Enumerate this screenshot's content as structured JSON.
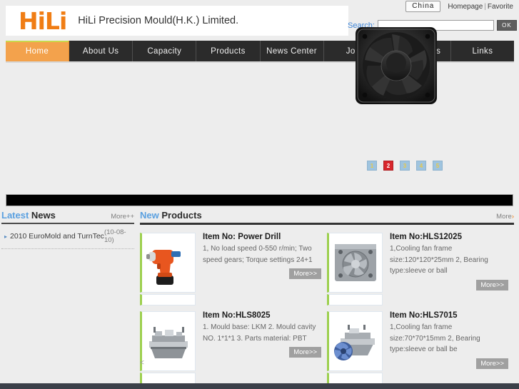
{
  "topbar": {
    "lang_button": "China",
    "homepage_link": "Homepage",
    "separator": "|",
    "favorite_link": "Favorite"
  },
  "header": {
    "logo_text": "HiLi",
    "company_name": "HiLi Precision Mould(H.K.) Limited."
  },
  "search": {
    "label": "Search:",
    "value": "",
    "placeholder": "",
    "button_label": "OK"
  },
  "nav": {
    "items": [
      {
        "label": "Home",
        "active": true
      },
      {
        "label": "About Us",
        "active": false
      },
      {
        "label": "Capacity",
        "active": false
      },
      {
        "label": "Products",
        "active": false
      },
      {
        "label": "News Center",
        "active": false
      },
      {
        "label": "Jobs",
        "active": false
      },
      {
        "label": "Contact Us",
        "active": false
      },
      {
        "label": "Links",
        "active": false
      }
    ]
  },
  "banner": {
    "image_alt": "cooling-fan",
    "dots": [
      {
        "label": "1",
        "active": false
      },
      {
        "label": "2",
        "active": true
      },
      {
        "label": "3",
        "active": false
      },
      {
        "label": "4",
        "active": false
      },
      {
        "label": "5",
        "active": false
      }
    ]
  },
  "news": {
    "title_highlight": "Latest",
    "title_rest": " News",
    "more_label": "More++",
    "items": [
      {
        "title": "2010 EuroMold and TurnTec",
        "date": "(10-08-10)"
      }
    ]
  },
  "products": {
    "title_highlight": "New",
    "title_rest": " Products",
    "more_label": "More",
    "more_arrow": "›",
    "prev_arrow": "<",
    "more_button_label": "More>>",
    "items": [
      {
        "title": "Item No: Power Drill",
        "desc": "1, No load speed 0-550 r/min; Two speed gears; Torque settings 24+1",
        "thumb": "power-drill"
      },
      {
        "title": "Item No:HLS12025",
        "desc": "1,Cooling fan frame size:120*120*25mm 2, Bearing type:sleeve or ball",
        "thumb": "fan-mould-12025"
      },
      {
        "title": "Item No:HLS8025",
        "desc": "1. Mould base: LKM 2. Mould cavity NO. 1*1*1 3. Parts material: PBT",
        "thumb": "mould-base-8025"
      },
      {
        "title": "Item No:HLS7015",
        "desc": "1,Cooling fan frame size:70*70*15mm 2, Bearing type:sleeve or ball be",
        "thumb": "fan-mould-7015"
      }
    ]
  },
  "colors": {
    "brand_orange": "#f07d14",
    "nav_active": "#f3a24c",
    "nav_bg": "#2b2b2b",
    "accent_blue": "#5aa0e0",
    "accent_green": "#9dd04f",
    "active_dot_red": "#d8262b",
    "footer": "#3b4049"
  }
}
